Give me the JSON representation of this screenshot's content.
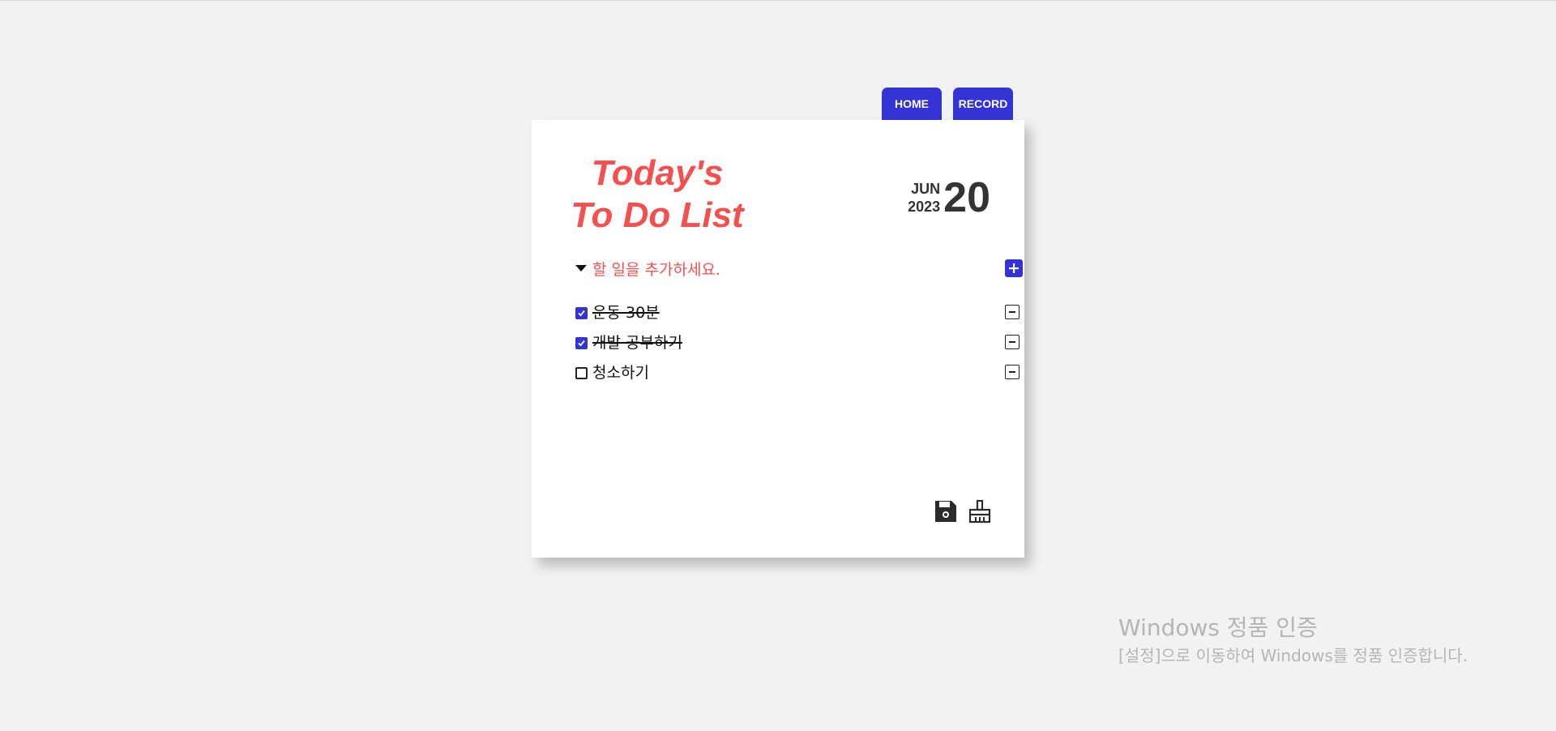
{
  "nav": {
    "home_label": "HOME",
    "record_label": "RECORD"
  },
  "header": {
    "title_line1": "Today's",
    "title_line2": "To Do List",
    "month": "JUN",
    "year": "2023",
    "day": "20"
  },
  "add": {
    "placeholder": "할 일을 추가하세요.",
    "button_icon": "plus-icon",
    "toggle_icon": "caret-down-icon"
  },
  "todos": [
    {
      "text": "운동 30분",
      "done": true
    },
    {
      "text": "개발 공부하기",
      "done": true
    },
    {
      "text": "청소하기",
      "done": false
    }
  ],
  "tools": {
    "save_icon": "floppy-disk-icon",
    "clear_icon": "broom-icon"
  },
  "watermark": {
    "title": "Windows 정품 인증",
    "body": "[설정]으로 이동하여 Windows를 정품 인증합니다."
  },
  "colors": {
    "accent": "#3333d6",
    "title": "#f45050",
    "background": "#f2f2f2"
  }
}
